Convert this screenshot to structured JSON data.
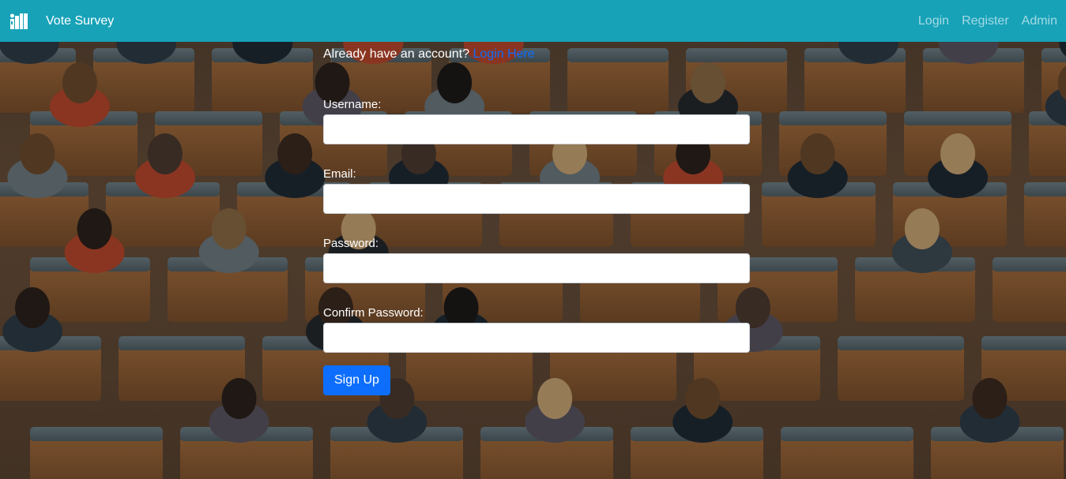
{
  "navbar": {
    "brand_icon": "ballot-box-icon",
    "brand_text": "Vote Survey",
    "links": [
      "Login",
      "Register",
      "Admin"
    ],
    "background": "#17a2b8"
  },
  "form": {
    "already_text": "Already have an account?",
    "login_link": "Login Here",
    "username_label": "Username:",
    "email_label": "Email:",
    "password_label": "Password:",
    "confirm_label": "Confirm Password:",
    "username_value": "",
    "email_value": "",
    "password_value": "",
    "confirm_value": "",
    "submit_label": "Sign Up",
    "link_color": "#0d6efd",
    "button_color": "#0d6efd"
  },
  "background": {
    "description_icon": "auditorium-audience-photo"
  }
}
